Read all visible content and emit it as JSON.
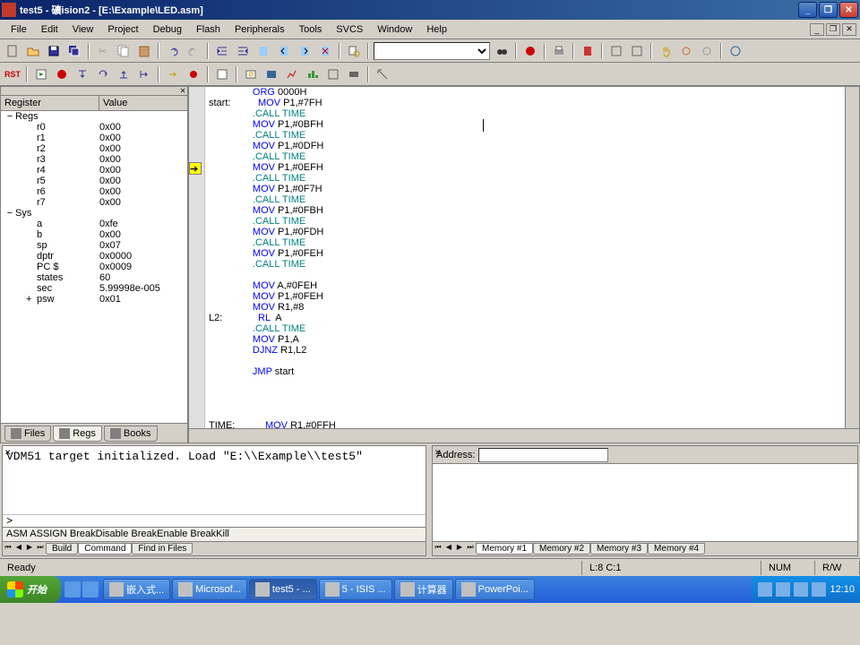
{
  "title": "test5  - 礦ision2 - [E:\\Example\\LED.asm]",
  "menu": {
    "items": [
      "File",
      "Edit",
      "View",
      "Project",
      "Debug",
      "Flash",
      "Peripherals",
      "Tools",
      "SVCS",
      "Window",
      "Help"
    ]
  },
  "register_panel": {
    "header": {
      "col1": "Register",
      "col2": "Value"
    },
    "groups": [
      {
        "name": "Regs",
        "expanded": true,
        "items": [
          {
            "name": "r0",
            "value": "0x00"
          },
          {
            "name": "r1",
            "value": "0x00"
          },
          {
            "name": "r2",
            "value": "0x00"
          },
          {
            "name": "r3",
            "value": "0x00"
          },
          {
            "name": "r4",
            "value": "0x00"
          },
          {
            "name": "r5",
            "value": "0x00"
          },
          {
            "name": "r6",
            "value": "0x00"
          },
          {
            "name": "r7",
            "value": "0x00"
          }
        ]
      },
      {
        "name": "Sys",
        "expanded": true,
        "items": [
          {
            "name": "a",
            "value": "0xfe"
          },
          {
            "name": "b",
            "value": "0x00"
          },
          {
            "name": "sp",
            "value": "0x07"
          },
          {
            "name": "dptr",
            "value": "0x0000"
          },
          {
            "name": "PC $",
            "value": "0x0009"
          },
          {
            "name": "states",
            "value": "60"
          },
          {
            "name": "sec",
            "value": "5.99998e-005"
          },
          {
            "name": "psw",
            "value": "0x01",
            "expandable": true
          }
        ]
      }
    ],
    "tabs": [
      "Files",
      "Regs",
      "Books"
    ],
    "active_tab": "Regs"
  },
  "editor": {
    "lines": [
      {
        "indent": "                ",
        "tokens": [
          {
            "t": "ORG",
            "c": "kw"
          },
          {
            "t": " 0000H"
          }
        ]
      },
      {
        "indent": "start:          ",
        "tokens": [
          {
            "t": "MOV",
            "c": "kw"
          },
          {
            "t": " P1,#7FH"
          }
        ]
      },
      {
        "indent": "                ",
        "tokens": [
          {
            "t": ".CALL TIME",
            "c": "dir"
          }
        ]
      },
      {
        "indent": "                ",
        "tokens": [
          {
            "t": "MOV",
            "c": "kw"
          },
          {
            "t": " P1,#0BFH"
          }
        ]
      },
      {
        "indent": "                ",
        "tokens": [
          {
            "t": ".CALL TIME",
            "c": "dir"
          }
        ]
      },
      {
        "indent": "                ",
        "tokens": [
          {
            "t": "MOV",
            "c": "kw"
          },
          {
            "t": " P1,#0DFH"
          }
        ]
      },
      {
        "indent": "                ",
        "tokens": [
          {
            "t": ".CALL TIME",
            "c": "dir"
          }
        ]
      },
      {
        "indent": "                ",
        "tokens": [
          {
            "t": "MOV",
            "c": "kw"
          },
          {
            "t": " P1,#0EFH"
          }
        ],
        "marker": true
      },
      {
        "indent": "                ",
        "tokens": [
          {
            "t": ".CALL TIME",
            "c": "dir"
          }
        ]
      },
      {
        "indent": "                ",
        "tokens": [
          {
            "t": "MOV",
            "c": "kw"
          },
          {
            "t": " P1,#0F7H"
          }
        ]
      },
      {
        "indent": "                ",
        "tokens": [
          {
            "t": ".CALL TIME",
            "c": "dir"
          }
        ]
      },
      {
        "indent": "                ",
        "tokens": [
          {
            "t": "MOV",
            "c": "kw"
          },
          {
            "t": " P1,#0FBH"
          }
        ]
      },
      {
        "indent": "                ",
        "tokens": [
          {
            "t": ".CALL TIME",
            "c": "dir"
          }
        ]
      },
      {
        "indent": "                ",
        "tokens": [
          {
            "t": "MOV",
            "c": "kw"
          },
          {
            "t": " P1,#0FDH"
          }
        ]
      },
      {
        "indent": "                ",
        "tokens": [
          {
            "t": ".CALL TIME",
            "c": "dir"
          }
        ]
      },
      {
        "indent": "                ",
        "tokens": [
          {
            "t": "MOV",
            "c": "kw"
          },
          {
            "t": " P1,#0FEH"
          }
        ]
      },
      {
        "indent": "                ",
        "tokens": [
          {
            "t": ".CALL TIME",
            "c": "dir"
          }
        ]
      },
      {
        "indent": "",
        "tokens": []
      },
      {
        "indent": "                ",
        "tokens": [
          {
            "t": "MOV",
            "c": "kw"
          },
          {
            "t": " A,#0FEH"
          }
        ]
      },
      {
        "indent": "                ",
        "tokens": [
          {
            "t": "MOV",
            "c": "kw"
          },
          {
            "t": " P1,#0FEH"
          }
        ]
      },
      {
        "indent": "                ",
        "tokens": [
          {
            "t": "MOV",
            "c": "kw"
          },
          {
            "t": " R1,#8"
          }
        ]
      },
      {
        "indent": "L2:             ",
        "tokens": [
          {
            "t": "RL",
            "c": "kw"
          },
          {
            "t": "  A"
          }
        ]
      },
      {
        "indent": "                ",
        "tokens": [
          {
            "t": ".CALL TIME",
            "c": "dir"
          }
        ]
      },
      {
        "indent": "                ",
        "tokens": [
          {
            "t": "MOV",
            "c": "kw"
          },
          {
            "t": " P1,A"
          }
        ]
      },
      {
        "indent": "                ",
        "tokens": [
          {
            "t": "DJNZ",
            "c": "kw"
          },
          {
            "t": " R1,L2"
          }
        ]
      },
      {
        "indent": "",
        "tokens": []
      },
      {
        "indent": "                ",
        "tokens": [
          {
            "t": "JMP",
            "c": "kw"
          },
          {
            "t": " start"
          }
        ]
      },
      {
        "indent": "",
        "tokens": []
      },
      {
        "indent": "",
        "tokens": []
      },
      {
        "indent": "",
        "tokens": []
      },
      {
        "indent": "",
        "tokens": []
      },
      {
        "indent": "TIME:           ",
        "tokens": [
          {
            "t": "MOV",
            "c": "kw"
          },
          {
            "t": " R1,#0FFH"
          }
        ]
      }
    ]
  },
  "output": {
    "lines": [
      "VDM51 target initialized.",
      "Load \"E:\\\\Example\\\\test5\""
    ],
    "prompt": ">",
    "hint": "ASM ASSIGN BreakDisable BreakEnable BreakKill",
    "tabs": [
      "Build",
      "Command",
      "Find in Files"
    ],
    "active_tab": "Command"
  },
  "memory": {
    "addr_label": "Address:",
    "addr_value": "",
    "tabs": [
      "Memory #1",
      "Memory #2",
      "Memory #3",
      "Memory #4"
    ],
    "active_tab": "Memory #1"
  },
  "status": {
    "ready": "Ready",
    "pos": "L:8 C:1",
    "num": "NUM",
    "rw": "R/W"
  },
  "taskbar": {
    "start": "开始",
    "tasks": [
      {
        "label": "嵌入式..."
      },
      {
        "label": "Microsof..."
      },
      {
        "label": "test5  - ...",
        "active": true
      },
      {
        "label": "5 - ISIS ..."
      },
      {
        "label": "计算器"
      },
      {
        "label": "PowerPoi..."
      }
    ],
    "clock": "12:10"
  }
}
